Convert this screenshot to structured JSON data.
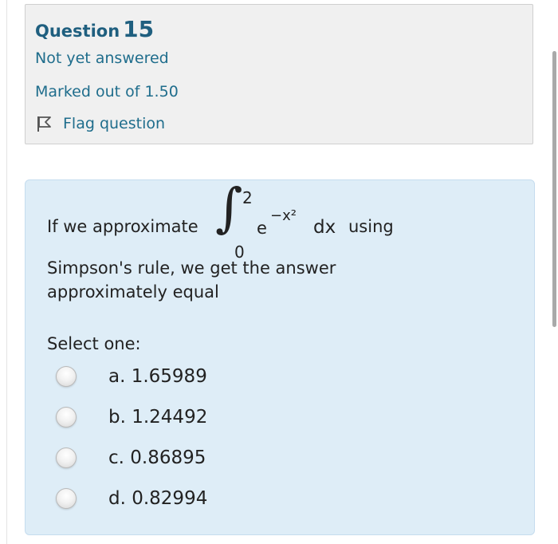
{
  "question_info": {
    "question_word": "Question",
    "question_number": "15",
    "status": "Not yet answered",
    "marks": "Marked out of 1.50",
    "flag_label": "Flag question"
  },
  "question": {
    "text_before": "If we approximate",
    "integral": {
      "upper_limit": "2",
      "lower_limit": "0",
      "base": "e",
      "exponent": "−x²",
      "differential": "dx"
    },
    "text_after": "using",
    "line2": "Simpson's rule, we get the answer",
    "line3": "approximately equal",
    "prompt": "Select one:",
    "options": [
      {
        "label": "a. 1.65989"
      },
      {
        "label": "b. 1.24492"
      },
      {
        "label": "c. 0.86895"
      },
      {
        "label": "d. 0.82994"
      }
    ]
  },
  "colors": {
    "info_background": "#f0f0f0",
    "content_background": "#deedf7",
    "link": "#1f6d8c"
  },
  "icons": [
    "flag-icon"
  ]
}
